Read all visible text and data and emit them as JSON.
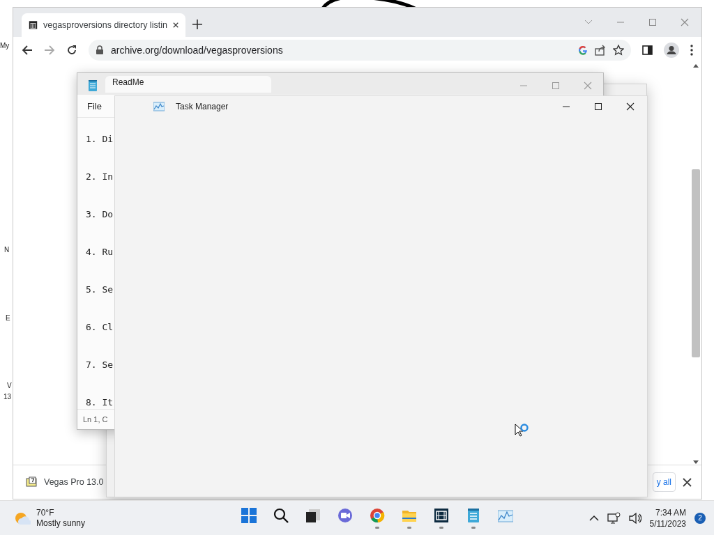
{
  "desktop_icons": [
    {
      "label": "My"
    },
    {
      "label": "N"
    },
    {
      "label": "E"
    },
    {
      "label": "V"
    },
    {
      "label": "13"
    }
  ],
  "browser": {
    "tabs": [
      {
        "title": "vegasproversions directory listin",
        "selected": true
      }
    ],
    "url": "archive.org/download/vegasproversions",
    "download_bar": {
      "file": "Vegas Pro 13.0",
      "show_all": "y all"
    }
  },
  "notepad": {
    "tab_title": "ReadMe",
    "menu": [
      "File"
    ],
    "lines": [
      "1. Di",
      "2. In",
      "3. Do",
      "4. Ru",
      "5. Se",
      "6. Cl",
      "7. Se",
      "8. It"
    ],
    "status": "Ln 1, C"
  },
  "task_manager": {
    "title": "Task Manager"
  },
  "taskbar": {
    "weather": {
      "temperature": "70°F",
      "condition": "Mostly sunny"
    },
    "apps": [
      {
        "kind": "start",
        "running": false
      },
      {
        "kind": "search",
        "running": false
      },
      {
        "kind": "taskview",
        "running": false
      },
      {
        "kind": "chat",
        "running": false
      },
      {
        "kind": "chrome",
        "running": true
      },
      {
        "kind": "explorer",
        "running": true
      },
      {
        "kind": "video",
        "running": true
      },
      {
        "kind": "notepad",
        "running": true
      },
      {
        "kind": "taskmanager",
        "running": false
      }
    ],
    "time": "7:34 AM",
    "date": "5/11/2023",
    "notifications": "2"
  }
}
